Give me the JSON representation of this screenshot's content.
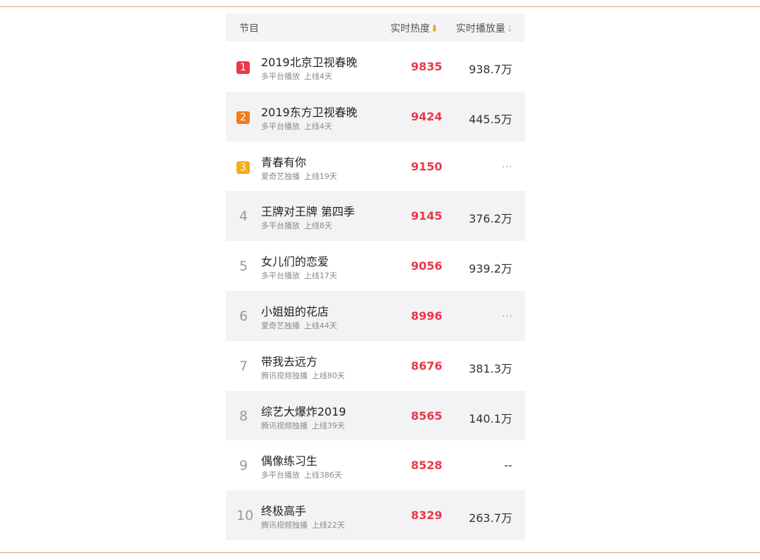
{
  "header": {
    "program_label": "节目",
    "heat_label": "实时热度",
    "heat_arrow": "⬇",
    "play_label": "实时播放量",
    "play_arrow": "↓"
  },
  "colors": {
    "rank1": "#e8394a",
    "rank2": "#f07d1a",
    "rank3": "#f5ac1d",
    "heat": "#e8394a",
    "frame": "#d9a66a"
  },
  "rows": [
    {
      "rank": "1",
      "name": "2019北京卫视春晚",
      "platform": "多平台播放",
      "online": "上线4天",
      "heat": "9835",
      "plays": "938.7万"
    },
    {
      "rank": "2",
      "name": "2019东方卫视春晚",
      "platform": "多平台播放",
      "online": "上线4天",
      "heat": "9424",
      "plays": "445.5万"
    },
    {
      "rank": "3",
      "name": "青春有你",
      "platform": "爱奇艺独播",
      "online": "上线19天",
      "heat": "9150",
      "plays": "···"
    },
    {
      "rank": "4",
      "name": "王牌对王牌 第四季",
      "platform": "多平台播放",
      "online": "上线8天",
      "heat": "9145",
      "plays": "376.2万"
    },
    {
      "rank": "5",
      "name": "女儿们的恋爱",
      "platform": "多平台播放",
      "online": "上线17天",
      "heat": "9056",
      "plays": "939.2万"
    },
    {
      "rank": "6",
      "name": "小姐姐的花店",
      "platform": "爱奇艺独播",
      "online": "上线44天",
      "heat": "8996",
      "plays": "···"
    },
    {
      "rank": "7",
      "name": "带我去远方",
      "platform": "腾讯视频独播",
      "online": "上线80天",
      "heat": "8676",
      "plays": "381.3万"
    },
    {
      "rank": "8",
      "name": "综艺大爆炸2019",
      "platform": "腾讯视频独播",
      "online": "上线39天",
      "heat": "8565",
      "plays": "140.1万"
    },
    {
      "rank": "9",
      "name": "偶像练习生",
      "platform": "多平台播放",
      "online": "上线386天",
      "heat": "8528",
      "plays": "--"
    },
    {
      "rank": "10",
      "name": "终极高手",
      "platform": "腾讯视频独播",
      "online": "上线22天",
      "heat": "8329",
      "plays": "263.7万"
    }
  ]
}
